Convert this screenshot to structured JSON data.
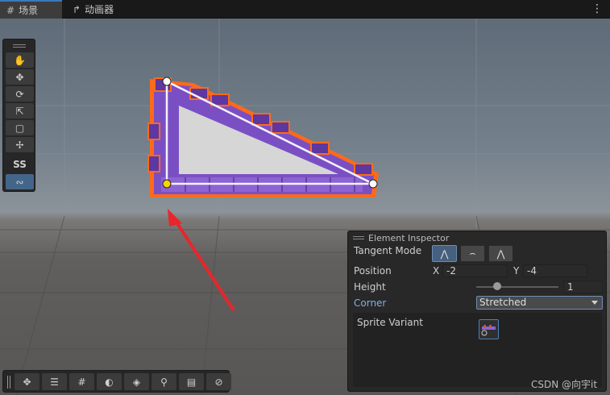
{
  "tabs": [
    {
      "label": "场景",
      "icon": "grid-icon",
      "active": true
    },
    {
      "label": "动画器",
      "icon": "animator-icon",
      "active": false
    }
  ],
  "menu_icon": "kebab-icon",
  "tools_overlay": {
    "buttons": [
      "hand-icon",
      "move-icon",
      "rotate-icon",
      "scale-icon",
      "rect-icon",
      "transform-icon"
    ],
    "custom_tool_label": "SS",
    "spline_tool_icon": "spline-edit-icon"
  },
  "bottom_toolbar": {
    "buttons": [
      "move-view-icon",
      "sliders-icon",
      "grid-snap-icon",
      "shading-icon",
      "layers-icon",
      "search-icon",
      "camera-icon",
      "compass-icon"
    ]
  },
  "inspector": {
    "title": "Element Inspector",
    "tangent_mode_label": "Tangent Mode",
    "tangent_buttons": [
      "linear-tangent-icon",
      "continuous-tangent-icon",
      "broken-tangent-icon"
    ],
    "position_label": "Position",
    "x_label": "X",
    "x_value": "-2",
    "y_label": "Y",
    "y_value": "-4",
    "height_label": "Height",
    "height_value": "1",
    "height_slider_fraction": 0.25,
    "corner_label": "Corner",
    "corner_value": "Stretched",
    "sprite_variant_label": "Sprite Variant"
  },
  "watermark": "CSDN @向宇it",
  "colors": {
    "accent": "#3a79bb",
    "shape_fill": "#7b4fc4",
    "outline": "#ff6a1a",
    "annotation_arrow": "#e8262b",
    "selected_point": "#f5d400"
  }
}
